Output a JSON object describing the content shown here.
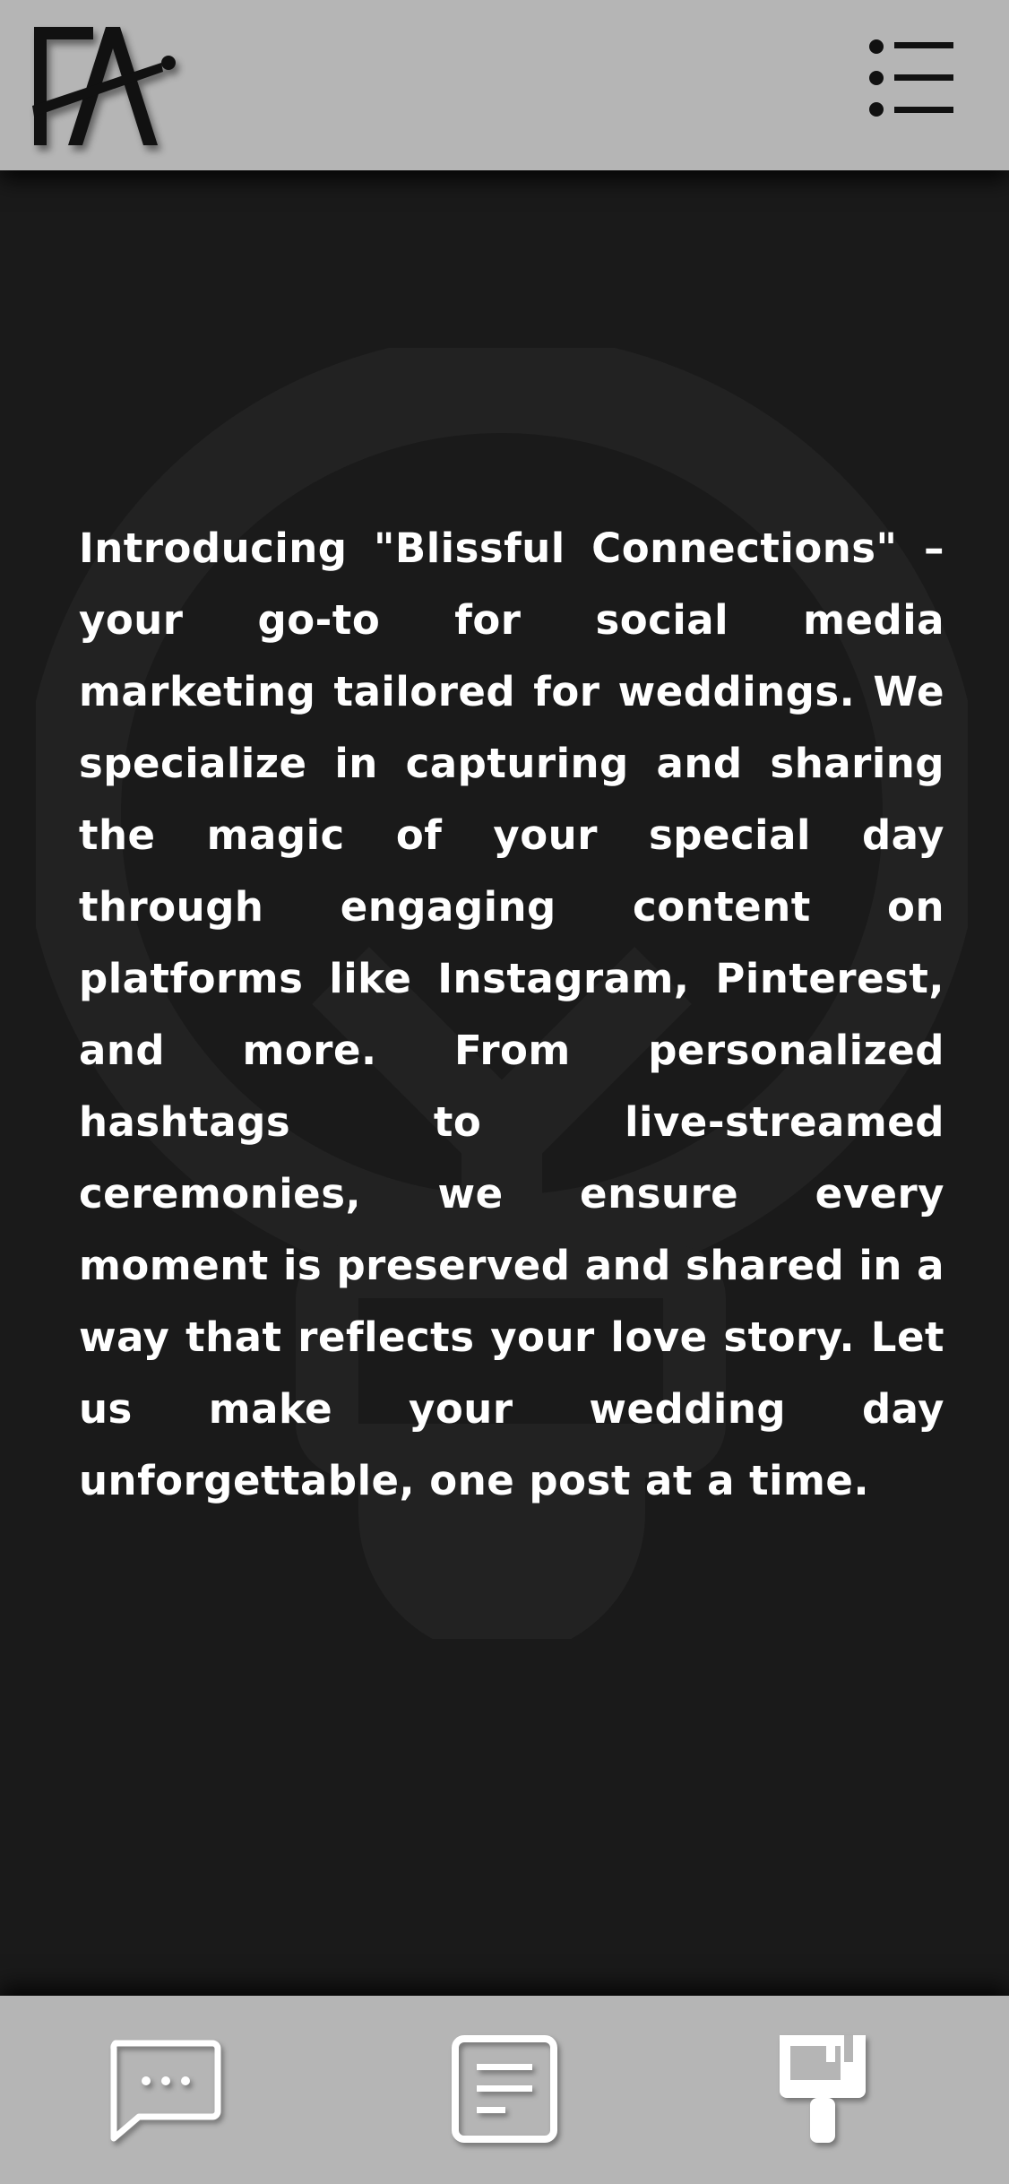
{
  "header": {
    "logo_text": "FA",
    "logo_icon": "fa-monogram-logo",
    "menu_icon": "menu-list-icon"
  },
  "main": {
    "intro_text": "Introducing \"Blissful Connections\" – your go-to for social media marketing tailored for weddings. We specialize in capturing and sharing the magic of your special day through engaging content on platforms like Instagram, Pinterest, and more. From personalized hashtags to live-streamed ceremonies, we ensure every moment is preserved and shared in a way that reflects your love story. Let us make your wedding day unforgettable, one post at a time.",
    "background_icon": "lightbulb-icon"
  },
  "bottom_nav": {
    "items": [
      {
        "icon": "chat-bubble-icon"
      },
      {
        "icon": "document-icon"
      },
      {
        "icon": "paint-brush-icon"
      }
    ]
  },
  "colors": {
    "bar_background": "#b5b5b5",
    "page_background": "#1a1a1a",
    "text": "#ffffff",
    "watermark": "#222222"
  }
}
